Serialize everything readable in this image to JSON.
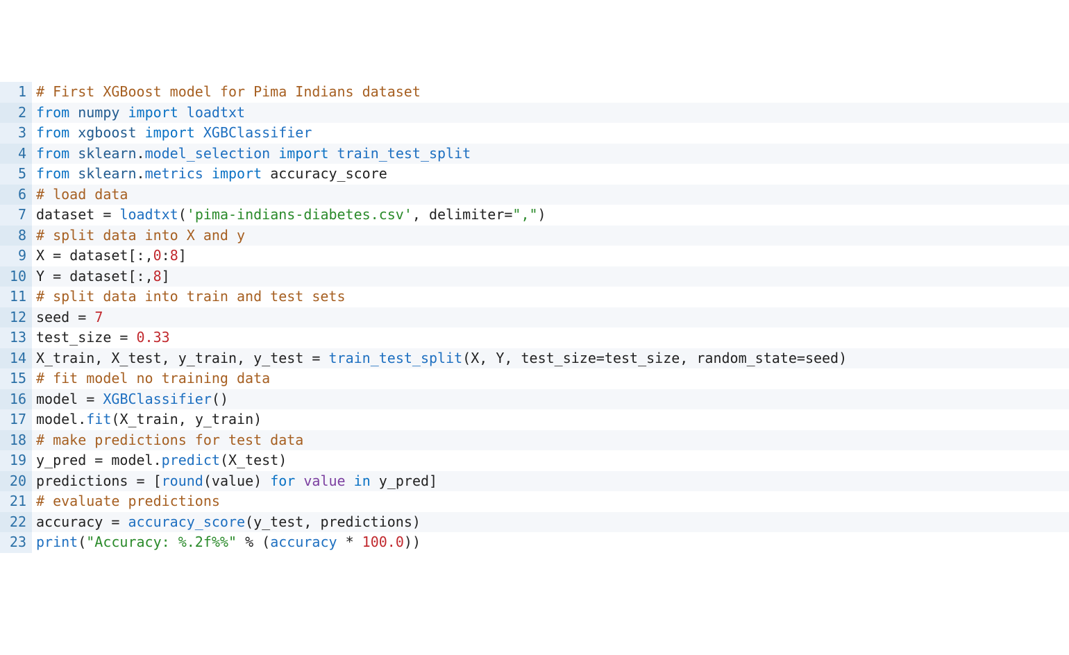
{
  "lines": [
    {
      "n": 1,
      "tokens": [
        {
          "t": "# First XGBoost model for Pima Indians dataset",
          "c": "c-comment"
        }
      ]
    },
    {
      "n": 2,
      "tokens": [
        {
          "t": "from",
          "c": "c-kw"
        },
        {
          "t": " ",
          "c": "c-plain"
        },
        {
          "t": "numpy",
          "c": "c-mod"
        },
        {
          "t": " ",
          "c": "c-plain"
        },
        {
          "t": "import",
          "c": "c-kw"
        },
        {
          "t": " ",
          "c": "c-plain"
        },
        {
          "t": "loadtxt",
          "c": "c-func"
        }
      ]
    },
    {
      "n": 3,
      "tokens": [
        {
          "t": "from",
          "c": "c-kw"
        },
        {
          "t": " ",
          "c": "c-plain"
        },
        {
          "t": "xgboost",
          "c": "c-mod"
        },
        {
          "t": " ",
          "c": "c-plain"
        },
        {
          "t": "import",
          "c": "c-kw"
        },
        {
          "t": " ",
          "c": "c-plain"
        },
        {
          "t": "XGBClassifier",
          "c": "c-func"
        }
      ]
    },
    {
      "n": 4,
      "tokens": [
        {
          "t": "from",
          "c": "c-kw"
        },
        {
          "t": " ",
          "c": "c-plain"
        },
        {
          "t": "sklearn",
          "c": "c-mod"
        },
        {
          "t": ".",
          "c": "c-plain"
        },
        {
          "t": "model_selection",
          "c": "c-attr"
        },
        {
          "t": " ",
          "c": "c-plain"
        },
        {
          "t": "import",
          "c": "c-kw"
        },
        {
          "t": " ",
          "c": "c-plain"
        },
        {
          "t": "train_test_split",
          "c": "c-func"
        }
      ]
    },
    {
      "n": 5,
      "tokens": [
        {
          "t": "from",
          "c": "c-kw"
        },
        {
          "t": " ",
          "c": "c-plain"
        },
        {
          "t": "sklearn",
          "c": "c-mod"
        },
        {
          "t": ".",
          "c": "c-plain"
        },
        {
          "t": "metrics",
          "c": "c-attr"
        },
        {
          "t": " ",
          "c": "c-plain"
        },
        {
          "t": "import",
          "c": "c-kw"
        },
        {
          "t": " ",
          "c": "c-plain"
        },
        {
          "t": "accuracy_score",
          "c": "c-plain"
        }
      ]
    },
    {
      "n": 6,
      "tokens": [
        {
          "t": "# load data",
          "c": "c-comment"
        }
      ]
    },
    {
      "n": 7,
      "tokens": [
        {
          "t": "dataset",
          "c": "c-plain"
        },
        {
          "t": " ",
          "c": "c-plain"
        },
        {
          "t": "=",
          "c": "c-op"
        },
        {
          "t": " ",
          "c": "c-plain"
        },
        {
          "t": "loadtxt",
          "c": "c-func"
        },
        {
          "t": "(",
          "c": "c-plain"
        },
        {
          "t": "'pima-indians-diabetes.csv'",
          "c": "c-str"
        },
        {
          "t": ", ",
          "c": "c-plain"
        },
        {
          "t": "delimiter",
          "c": "c-plain"
        },
        {
          "t": "=",
          "c": "c-op"
        },
        {
          "t": "\",\"",
          "c": "c-str"
        },
        {
          "t": ")",
          "c": "c-plain"
        }
      ]
    },
    {
      "n": 8,
      "tokens": [
        {
          "t": "# split data into X and y",
          "c": "c-comment"
        }
      ]
    },
    {
      "n": 9,
      "tokens": [
        {
          "t": "X",
          "c": "c-plain"
        },
        {
          "t": " ",
          "c": "c-plain"
        },
        {
          "t": "=",
          "c": "c-op"
        },
        {
          "t": " ",
          "c": "c-plain"
        },
        {
          "t": "dataset",
          "c": "c-plain"
        },
        {
          "t": "[",
          "c": "c-plain"
        },
        {
          "t": ":",
          "c": "c-op"
        },
        {
          "t": ",",
          "c": "c-plain"
        },
        {
          "t": "0",
          "c": "c-num"
        },
        {
          "t": ":",
          "c": "c-op"
        },
        {
          "t": "8",
          "c": "c-num"
        },
        {
          "t": "]",
          "c": "c-plain"
        }
      ]
    },
    {
      "n": 10,
      "tokens": [
        {
          "t": "Y",
          "c": "c-plain"
        },
        {
          "t": " ",
          "c": "c-plain"
        },
        {
          "t": "=",
          "c": "c-op"
        },
        {
          "t": " ",
          "c": "c-plain"
        },
        {
          "t": "dataset",
          "c": "c-plain"
        },
        {
          "t": "[",
          "c": "c-plain"
        },
        {
          "t": ":",
          "c": "c-op"
        },
        {
          "t": ",",
          "c": "c-plain"
        },
        {
          "t": "8",
          "c": "c-num"
        },
        {
          "t": "]",
          "c": "c-plain"
        }
      ]
    },
    {
      "n": 11,
      "tokens": [
        {
          "t": "# split data into train and test sets",
          "c": "c-comment"
        }
      ]
    },
    {
      "n": 12,
      "tokens": [
        {
          "t": "seed",
          "c": "c-plain"
        },
        {
          "t": " ",
          "c": "c-plain"
        },
        {
          "t": "=",
          "c": "c-op"
        },
        {
          "t": " ",
          "c": "c-plain"
        },
        {
          "t": "7",
          "c": "c-num"
        }
      ]
    },
    {
      "n": 13,
      "tokens": [
        {
          "t": "test_size",
          "c": "c-plain"
        },
        {
          "t": " ",
          "c": "c-plain"
        },
        {
          "t": "=",
          "c": "c-op"
        },
        {
          "t": " ",
          "c": "c-plain"
        },
        {
          "t": "0.33",
          "c": "c-num"
        }
      ]
    },
    {
      "n": 14,
      "tokens": [
        {
          "t": "X_train",
          "c": "c-plain"
        },
        {
          "t": ", ",
          "c": "c-plain"
        },
        {
          "t": "X_test",
          "c": "c-plain"
        },
        {
          "t": ", ",
          "c": "c-plain"
        },
        {
          "t": "y_train",
          "c": "c-plain"
        },
        {
          "t": ", ",
          "c": "c-plain"
        },
        {
          "t": "y_test",
          "c": "c-plain"
        },
        {
          "t": " ",
          "c": "c-plain"
        },
        {
          "t": "=",
          "c": "c-op"
        },
        {
          "t": " ",
          "c": "c-plain"
        },
        {
          "t": "train_test_split",
          "c": "c-func"
        },
        {
          "t": "(",
          "c": "c-plain"
        },
        {
          "t": "X",
          "c": "c-plain"
        },
        {
          "t": ", ",
          "c": "c-plain"
        },
        {
          "t": "Y",
          "c": "c-plain"
        },
        {
          "t": ", ",
          "c": "c-plain"
        },
        {
          "t": "test_size",
          "c": "c-plain"
        },
        {
          "t": "=",
          "c": "c-op"
        },
        {
          "t": "test_size",
          "c": "c-plain"
        },
        {
          "t": ", ",
          "c": "c-plain"
        },
        {
          "t": "random_state",
          "c": "c-plain"
        },
        {
          "t": "=",
          "c": "c-op"
        },
        {
          "t": "seed",
          "c": "c-plain"
        },
        {
          "t": ")",
          "c": "c-plain"
        }
      ]
    },
    {
      "n": 15,
      "tokens": [
        {
          "t": "# fit model no training data",
          "c": "c-comment"
        }
      ]
    },
    {
      "n": 16,
      "tokens": [
        {
          "t": "model",
          "c": "c-plain"
        },
        {
          "t": " ",
          "c": "c-plain"
        },
        {
          "t": "=",
          "c": "c-op"
        },
        {
          "t": " ",
          "c": "c-plain"
        },
        {
          "t": "XGBClassifier",
          "c": "c-func"
        },
        {
          "t": "()",
          "c": "c-plain"
        }
      ]
    },
    {
      "n": 17,
      "tokens": [
        {
          "t": "model",
          "c": "c-plain"
        },
        {
          "t": ".",
          "c": "c-plain"
        },
        {
          "t": "fit",
          "c": "c-attr"
        },
        {
          "t": "(",
          "c": "c-plain"
        },
        {
          "t": "X_train",
          "c": "c-plain"
        },
        {
          "t": ", ",
          "c": "c-plain"
        },
        {
          "t": "y_train",
          "c": "c-plain"
        },
        {
          "t": ")",
          "c": "c-plain"
        }
      ]
    },
    {
      "n": 18,
      "tokens": [
        {
          "t": "# make predictions for test data",
          "c": "c-comment"
        }
      ]
    },
    {
      "n": 19,
      "tokens": [
        {
          "t": "y_pred",
          "c": "c-plain"
        },
        {
          "t": " ",
          "c": "c-plain"
        },
        {
          "t": "=",
          "c": "c-op"
        },
        {
          "t": " ",
          "c": "c-plain"
        },
        {
          "t": "model",
          "c": "c-plain"
        },
        {
          "t": ".",
          "c": "c-plain"
        },
        {
          "t": "predict",
          "c": "c-attr"
        },
        {
          "t": "(",
          "c": "c-plain"
        },
        {
          "t": "X_test",
          "c": "c-plain"
        },
        {
          "t": ")",
          "c": "c-plain"
        }
      ]
    },
    {
      "n": 20,
      "tokens": [
        {
          "t": "predictions",
          "c": "c-plain"
        },
        {
          "t": " ",
          "c": "c-plain"
        },
        {
          "t": "=",
          "c": "c-op"
        },
        {
          "t": " ",
          "c": "c-plain"
        },
        {
          "t": "[",
          "c": "c-plain"
        },
        {
          "t": "round",
          "c": "c-builtin"
        },
        {
          "t": "(",
          "c": "c-plain"
        },
        {
          "t": "value",
          "c": "c-plain"
        },
        {
          "t": ")",
          "c": "c-plain"
        },
        {
          "t": " ",
          "c": "c-plain"
        },
        {
          "t": "for",
          "c": "c-kw"
        },
        {
          "t": " ",
          "c": "c-plain"
        },
        {
          "t": "value",
          "c": "c-param"
        },
        {
          "t": " ",
          "c": "c-plain"
        },
        {
          "t": "in",
          "c": "c-kw"
        },
        {
          "t": " ",
          "c": "c-plain"
        },
        {
          "t": "y_pred",
          "c": "c-plain"
        },
        {
          "t": "]",
          "c": "c-plain"
        }
      ]
    },
    {
      "n": 21,
      "tokens": [
        {
          "t": "# evaluate predictions",
          "c": "c-comment"
        }
      ]
    },
    {
      "n": 22,
      "tokens": [
        {
          "t": "accuracy",
          "c": "c-plain"
        },
        {
          "t": " ",
          "c": "c-plain"
        },
        {
          "t": "=",
          "c": "c-op"
        },
        {
          "t": " ",
          "c": "c-plain"
        },
        {
          "t": "accuracy_score",
          "c": "c-func"
        },
        {
          "t": "(",
          "c": "c-plain"
        },
        {
          "t": "y_test",
          "c": "c-plain"
        },
        {
          "t": ", ",
          "c": "c-plain"
        },
        {
          "t": "predictions",
          "c": "c-plain"
        },
        {
          "t": ")",
          "c": "c-plain"
        }
      ]
    },
    {
      "n": 23,
      "tokens": [
        {
          "t": "print",
          "c": "c-builtin"
        },
        {
          "t": "(",
          "c": "c-plain"
        },
        {
          "t": "\"Accuracy: %.2f%%\"",
          "c": "c-str"
        },
        {
          "t": " ",
          "c": "c-plain"
        },
        {
          "t": "%",
          "c": "c-op"
        },
        {
          "t": " ",
          "c": "c-plain"
        },
        {
          "t": "(",
          "c": "c-plain"
        },
        {
          "t": "accuracy",
          "c": "c-func"
        },
        {
          "t": " ",
          "c": "c-plain"
        },
        {
          "t": "*",
          "c": "c-op"
        },
        {
          "t": " ",
          "c": "c-plain"
        },
        {
          "t": "100.0",
          "c": "c-num"
        },
        {
          "t": ")",
          "c": "c-plain"
        },
        {
          "t": ")",
          "c": "c-plain"
        }
      ]
    }
  ]
}
